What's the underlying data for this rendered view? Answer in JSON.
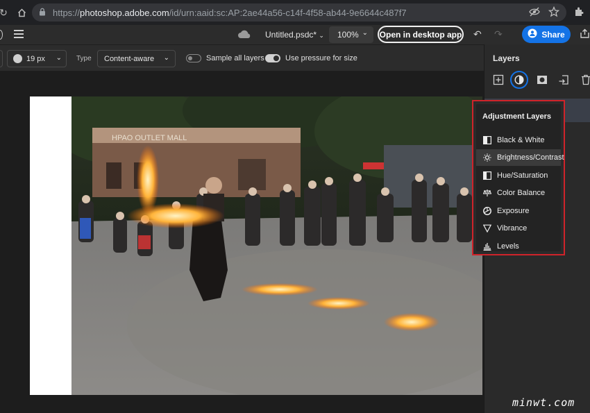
{
  "browser": {
    "url_scheme": "https://",
    "url_host": "photoshop.adobe.com",
    "url_path": "/id/urn:aaid:sc:AP:2ae44a56-c14f-4f58-ab44-9e6644c487f7"
  },
  "header": {
    "doc_name": "Untitled.psdc*",
    "zoom": "100%",
    "open_desktop_label": "Open in desktop app",
    "share_label": "Share"
  },
  "options": {
    "brush_size": "19 px",
    "type_label": "Type",
    "type_value": "Content-aware",
    "sample_all_layers_label": "Sample all layers",
    "sample_all_layers_on": false,
    "pressure_label": "Use pressure for size",
    "pressure_on": true
  },
  "layers_panel": {
    "title": "Layers"
  },
  "adjustment_menu": {
    "title": "Adjustment Layers",
    "items": [
      {
        "label": "Black & White",
        "icon": "black-white-icon"
      },
      {
        "label": "Brightness/Contrast",
        "icon": "brightness-icon"
      },
      {
        "label": "Hue/Saturation",
        "icon": "hue-saturation-icon"
      },
      {
        "label": "Color Balance",
        "icon": "color-balance-icon"
      },
      {
        "label": "Exposure",
        "icon": "exposure-icon"
      },
      {
        "label": "Vibrance",
        "icon": "vibrance-icon"
      },
      {
        "label": "Levels",
        "icon": "levels-icon"
      }
    ],
    "highlighted_index": 1
  },
  "photo": {
    "sign_text": "HPAO OUTLET MALL"
  },
  "watermark": "minwt.com",
  "colors": {
    "accent": "#1473e6",
    "highlight_border": "#d0232a",
    "fire": "#ff9a1f"
  }
}
